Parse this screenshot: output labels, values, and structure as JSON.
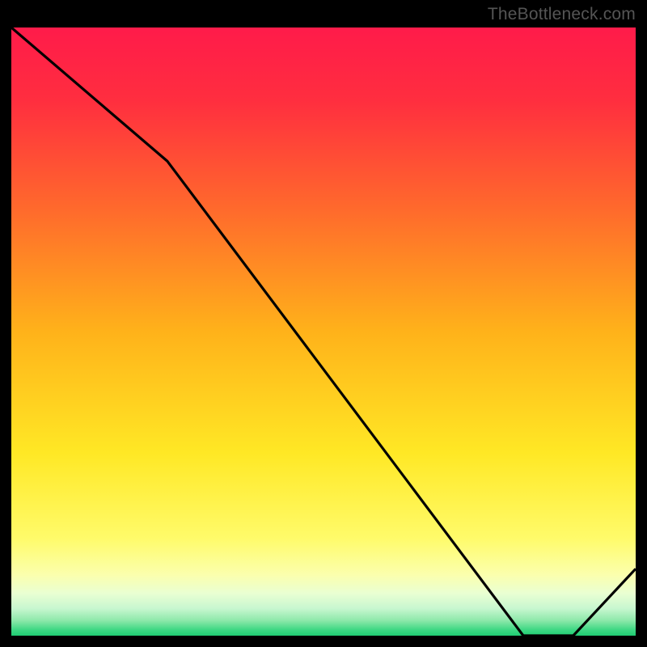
{
  "watermark": "TheBottleneck.com",
  "bottom_label": "",
  "chart_data": {
    "type": "line",
    "title": "",
    "xlabel": "",
    "ylabel": "",
    "xlim": [
      0,
      100
    ],
    "ylim": [
      0,
      100
    ],
    "x": [
      0,
      25,
      82,
      90,
      100
    ],
    "values": [
      100,
      78,
      0,
      0,
      11
    ],
    "gradient_stops": [
      {
        "pos": 0.0,
        "color": "#ff1b4a"
      },
      {
        "pos": 0.12,
        "color": "#ff2e3f"
      },
      {
        "pos": 0.3,
        "color": "#ff6a2c"
      },
      {
        "pos": 0.5,
        "color": "#ffb21a"
      },
      {
        "pos": 0.7,
        "color": "#ffe825"
      },
      {
        "pos": 0.84,
        "color": "#fffb6a"
      },
      {
        "pos": 0.9,
        "color": "#fbffad"
      },
      {
        "pos": 0.93,
        "color": "#eaffd2"
      },
      {
        "pos": 0.955,
        "color": "#c8f7d0"
      },
      {
        "pos": 0.975,
        "color": "#8de8aa"
      },
      {
        "pos": 0.99,
        "color": "#3fd884"
      },
      {
        "pos": 1.0,
        "color": "#1fcd73"
      }
    ]
  }
}
